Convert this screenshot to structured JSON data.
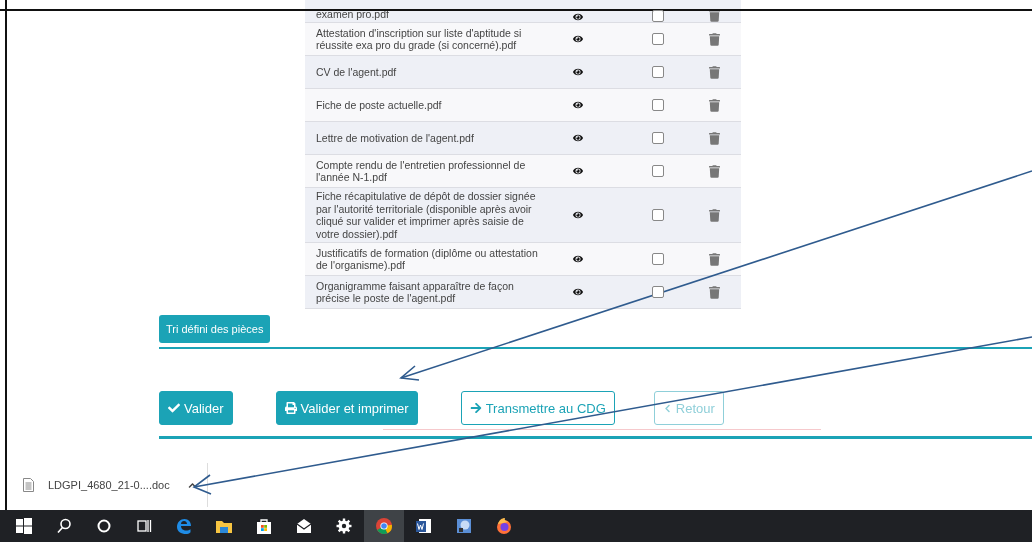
{
  "table": {
    "rows": [
      {
        "name": "examen pro.pdf",
        "checked": false,
        "partial": true
      },
      {
        "name": "Attestation d'inscription sur liste d'aptitude si réussite exa pro du grade (si concerné).pdf",
        "checked": false,
        "partial": false
      },
      {
        "name": "CV de l'agent.pdf",
        "checked": false,
        "partial": false
      },
      {
        "name": "Fiche de poste actuelle.pdf",
        "checked": false,
        "partial": false
      },
      {
        "name": "Lettre de motivation de l'agent.pdf",
        "checked": false,
        "partial": false
      },
      {
        "name": "Compte rendu de l'entretien professionnel de l'année N-1.pdf",
        "checked": false,
        "partial": false
      },
      {
        "name": "Fiche récapitulative de dépôt de dossier signée par l'autorité territoriale (disponible après avoir cliqué sur valider et imprimer après saisie de votre dossier).pdf",
        "checked": false,
        "partial": false
      },
      {
        "name": "Justificatifs de formation (diplôme ou attestation de l'organisme).pdf",
        "checked": false,
        "partial": false
      },
      {
        "name": "Organigramme faisant apparaître de façon précise le poste de l'agent.pdf",
        "checked": false,
        "partial": false
      }
    ]
  },
  "sort_button": "Tri défini des pièces",
  "actions": [
    {
      "kind": "solid",
      "label": "Valider",
      "disabled": false
    },
    {
      "kind": "solid",
      "label": "Valider et imprimer",
      "disabled": false
    },
    {
      "kind": "outline",
      "label": "Transmettre au CDG",
      "disabled": false
    },
    {
      "kind": "outline",
      "label": "Retour",
      "disabled": true
    }
  ],
  "download_bar": {
    "filename": "LDGPI_4680_21-0....doc"
  },
  "taskbar": [
    {
      "kind": "start",
      "active": false
    },
    {
      "kind": "search",
      "active": false
    },
    {
      "kind": "cortana",
      "active": false
    },
    {
      "kind": "taskview",
      "active": false
    },
    {
      "kind": "edge",
      "active": false
    },
    {
      "kind": "explorer",
      "active": false
    },
    {
      "kind": "store",
      "active": false
    },
    {
      "kind": "mail",
      "active": false
    },
    {
      "kind": "settings",
      "active": false
    },
    {
      "kind": "chrome",
      "active": true
    },
    {
      "kind": "word",
      "active": false
    },
    {
      "kind": "app",
      "active": false
    },
    {
      "kind": "firefox",
      "active": false
    }
  ]
}
